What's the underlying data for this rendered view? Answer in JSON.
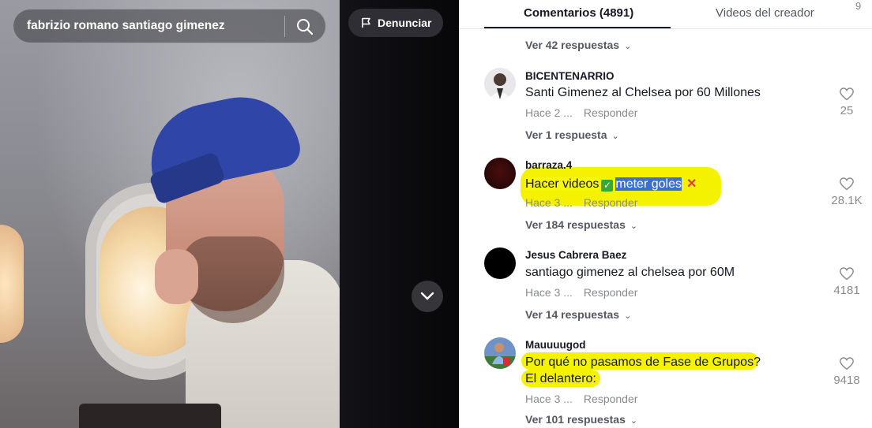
{
  "search": {
    "query": "fabrizio romano santiago gimenez",
    "icon": "search-icon"
  },
  "report_button": {
    "label": "Denunciar",
    "icon": "flag-icon"
  },
  "video_nav": {
    "icon": "chevron-down-icon"
  },
  "tabs": {
    "comments": "Comentarios (4891)",
    "creator_videos": "Videos del creador",
    "more": "9"
  },
  "top_replies_link": "Ver 42 respuestas",
  "comments": [
    {
      "username": "BICENTENARRIO",
      "text": "Santi Gimenez al Chelsea por 60 Millones",
      "time": "Hace 2 ...",
      "reply_label": "Responder",
      "likes": "25",
      "replies_link": "Ver 1 respuesta"
    },
    {
      "username": "barraza.4",
      "text_part1": "Hacer videos",
      "text_part2": "meter goles",
      "time": "Hace 3 ...",
      "reply_label": "Responder",
      "likes": "28.1K",
      "replies_link": "Ver 184 respuestas"
    },
    {
      "username": "Jesus Cabrera Baez",
      "text": "santiago gimenez al chelsea por 60M",
      "time": "Hace 3 ...",
      "reply_label": "Responder",
      "likes": "4181",
      "replies_link": "Ver 14 respuestas"
    },
    {
      "username": "Mauuuugod",
      "text_line1": "Por qué no pasamos de Fase de Grupos?",
      "text_line2": "El delantero:",
      "time": "Hace 3 ...",
      "reply_label": "Responder",
      "likes": "9418",
      "replies_link": "Ver 101 respuestas"
    }
  ],
  "colors": {
    "highlight": "#f5f200",
    "panel_text": "#161823",
    "muted_text": "#8a8b91"
  }
}
